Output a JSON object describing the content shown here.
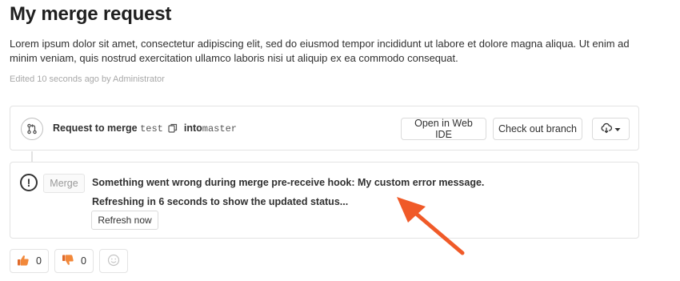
{
  "page": {
    "title": "My merge request",
    "description": "Lorem ipsum dolor sit amet, consectetur adipiscing elit, sed do eiusmod tempor incididunt ut labore et dolore magna aliqua. Ut enim ad minim veniam, quis nostrud exercitation ullamco laboris nisi ut aliquip ex ea commodo consequat.",
    "edited_text": "Edited 10 seconds ago by Administrator"
  },
  "merge_widget": {
    "request_label": "Request to merge",
    "source_branch": "test",
    "into_label": "into",
    "target_branch": "master",
    "open_web_ide_label": "Open in Web IDE",
    "check_out_branch_label": "Check out branch",
    "icons": {
      "branch": "merge-request-icon",
      "copy": "copy-icon",
      "download": "download-icon",
      "dropdown": "chevron-down-icon"
    }
  },
  "error_widget": {
    "merge_button_label": "Merge",
    "error_message": "Something went wrong during merge pre-receive hook: My custom error message.",
    "refresh_message": "Refreshing in 6 seconds to show the updated status...",
    "refresh_button_label": "Refresh now",
    "icons": {
      "status": "warning-icon"
    },
    "annotation_arrow_color": "#f05a28"
  },
  "awards": {
    "thumbs_up_count": "0",
    "thumbs_down_count": "0",
    "icons": {
      "thumbs_up": "thumbs-up-icon",
      "thumbs_down": "thumbs-down-icon",
      "add": "smiley-icon"
    }
  }
}
